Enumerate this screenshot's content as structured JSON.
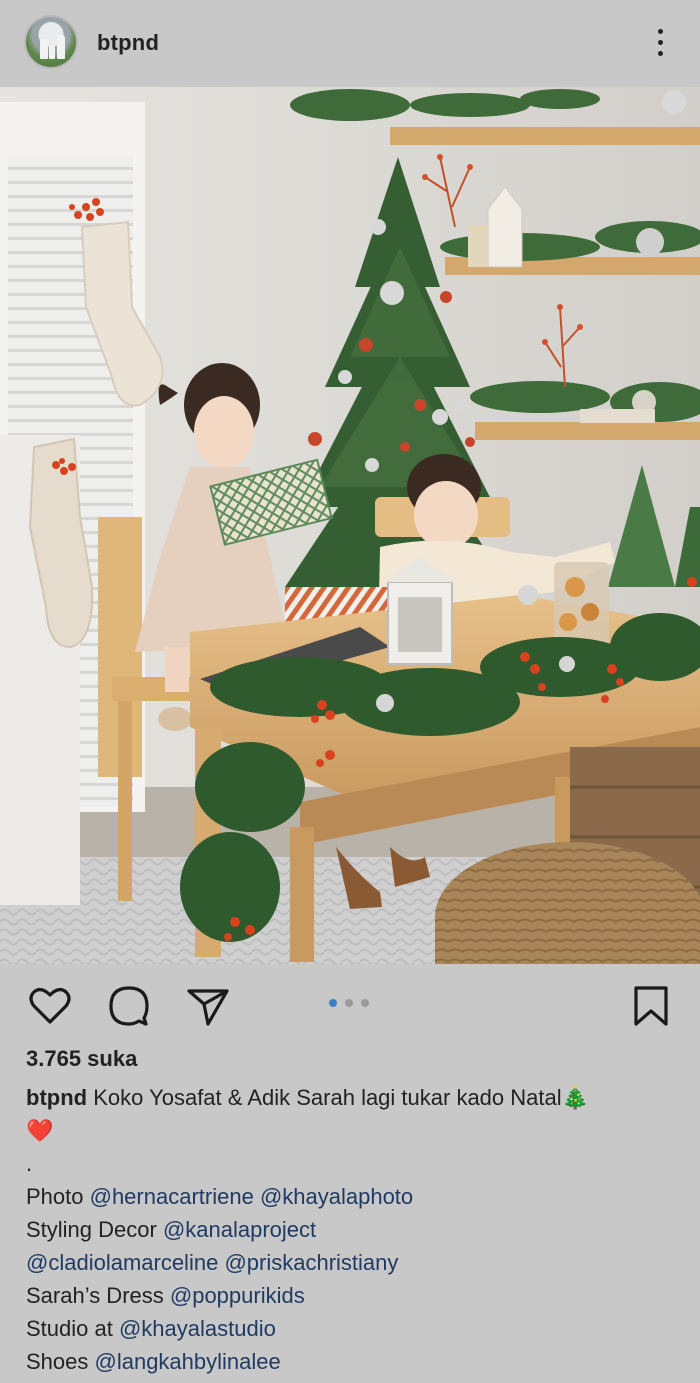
{
  "post": {
    "username": "btpnd",
    "likes": "3.765 suka",
    "caption": {
      "username": "btpnd",
      "text": " Koko Yosafat & Adik Sarah lagi tukar kado Natal🎄",
      "emoji_line": "❤️",
      "dot_line": ".",
      "credits": [
        {
          "label": "Photo ",
          "mentions": [
            "@hernacartriene",
            "@khayalaphoto"
          ]
        },
        {
          "label": "Styling Decor ",
          "mentions": [
            "@kanalaproject"
          ]
        },
        {
          "label": "",
          "mentions": [
            "@cladiolamarceline",
            "@priskachristiany"
          ]
        },
        {
          "label": "Sarah’s Dress ",
          "mentions": [
            "@poppurikids"
          ]
        },
        {
          "label": "Studio at ",
          "mentions": [
            "@khayalastudio"
          ]
        },
        {
          "label": "Shoes ",
          "mentions": [
            "@langkahbylinalee"
          ]
        }
      ]
    },
    "carousel": {
      "total": 3,
      "active": 1
    }
  },
  "icons": {
    "avatar": "profile-avatar",
    "more": "more-vertical-icon",
    "like": "heart-icon",
    "comment": "comment-icon",
    "share": "send-icon",
    "save": "bookmark-icon"
  },
  "colors": {
    "background": "#c8c8c8",
    "mention": "#1f3a63",
    "carousel_active": "#3b82c4",
    "carousel_inactive": "#9a9a9a"
  }
}
